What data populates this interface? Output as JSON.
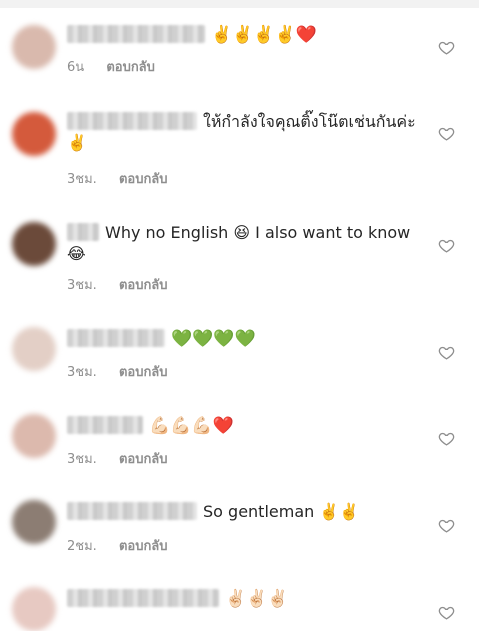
{
  "comments": [
    {
      "text": "✌️✌️✌️✌️❤️",
      "time": "6น",
      "reply": "ตอบกลับ",
      "avatar_color": "#d9b9ad",
      "uname_w": 138
    },
    {
      "text": "ให้กำลังใจคุณติ๊งโน๊ตเช่นกันค่ะ ✌️",
      "time": "3ชม.",
      "reply": "ตอบกลับ",
      "avatar_color": "#d45a3c",
      "uname_w": 130
    },
    {
      "text": "Why no English 😆 I also want to know 😂",
      "time": "3ชม.",
      "reply": "ตอบกลับ",
      "avatar_color": "#6b4a3a",
      "uname_w": 32
    },
    {
      "text": "💚💚💚💚",
      "time": "3ชม.",
      "reply": "ตอบกลับ",
      "avatar_color": "#e3cfc6",
      "uname_w": 98
    },
    {
      "text": "💪🏻💪🏻💪🏻❤️",
      "time": "3ชม.",
      "reply": "ตอบกลับ",
      "avatar_color": "#dcb9ad",
      "uname_w": 76
    },
    {
      "text": "So gentleman ✌️✌️",
      "time": "2ชม.",
      "reply": "ตอบกลับ",
      "avatar_color": "#8c7d73",
      "uname_w": 130
    },
    {
      "text": "✌🏻✌🏻✌🏻",
      "time": "",
      "reply": "",
      "avatar_color": "#e7c9c2",
      "uname_w": 152
    }
  ]
}
